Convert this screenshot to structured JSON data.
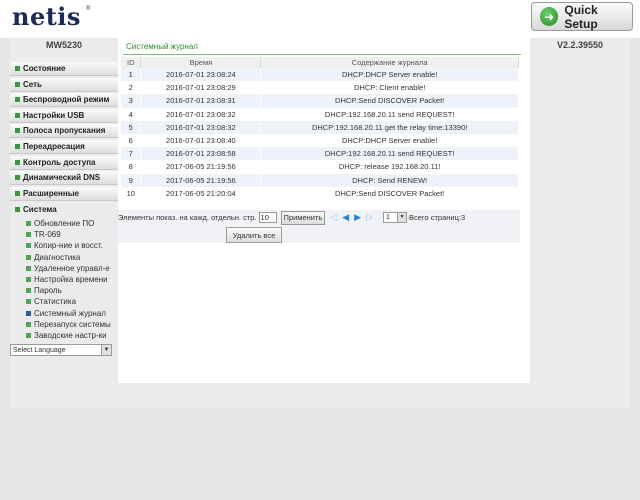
{
  "header": {
    "logo": "netis",
    "logo_mark": "®",
    "quick_setup": "Quick Setup"
  },
  "model": "MW5230",
  "version": "V2.2.39550",
  "sidebar": {
    "items": [
      {
        "label": "Состояние"
      },
      {
        "label": "Сеть"
      },
      {
        "label": "Беспроводной режим"
      },
      {
        "label": "Настройки USB"
      },
      {
        "label": "Полоса пропускания"
      },
      {
        "label": "Переадресация"
      },
      {
        "label": "Контроль доступа"
      },
      {
        "label": "Динамический DNS"
      },
      {
        "label": "Расширенные"
      },
      {
        "label": "Система"
      }
    ],
    "system_sub": [
      {
        "label": "Обновление ПО"
      },
      {
        "label": "TR-069"
      },
      {
        "label": "Копир-ние и восст."
      },
      {
        "label": "Диагностика"
      },
      {
        "label": "Удаленное управл-е"
      },
      {
        "label": "Настройка времени"
      },
      {
        "label": "Пароль"
      },
      {
        "label": "Статистика"
      },
      {
        "label": "Системный журнал"
      },
      {
        "label": "Перезапуск системы"
      },
      {
        "label": "Заводские настр-ки"
      }
    ],
    "language": "Select Language"
  },
  "log": {
    "title": "Системный журнал",
    "columns": [
      "ID",
      "Время",
      "Содержание журнала"
    ],
    "rows": [
      {
        "id": "1",
        "time": "2016-07-01 23:08:24",
        "msg": "DHCP:DHCP Server enable!"
      },
      {
        "id": "2",
        "time": "2016-07-01 23:08:29",
        "msg": "DHCP: Client enable!"
      },
      {
        "id": "3",
        "time": "2016-07-01 23:08:31",
        "msg": "DHCP:Send DISCOVER Packet!"
      },
      {
        "id": "4",
        "time": "2016-07-01 23:08:32",
        "msg": "DHCP:192.168.20.11 send REQUEST!"
      },
      {
        "id": "5",
        "time": "2016-07-01 23:08:32",
        "msg": "DHCP:192.168.20.11 get the relay time:13390!"
      },
      {
        "id": "6",
        "time": "2016-07-01 23:08:40",
        "msg": "DHCP:DHCP Server enable!"
      },
      {
        "id": "7",
        "time": "2016-07-01 23:08:58",
        "msg": "DHCP:192.168.20.11 send REQUEST!"
      },
      {
        "id": "8",
        "time": "2017-06-05 21:19:56",
        "msg": "DHCP: release 192.168.20.11!"
      },
      {
        "id": "9",
        "time": "2017-06-05 21:19:56",
        "msg": "DHCP: Send RENEW!"
      },
      {
        "id": "10",
        "time": "2017-06-05 21:20:04",
        "msg": "DHCP:Send DISCOVER Packet!"
      }
    ]
  },
  "pager": {
    "per_page_label": "Элементы показ. на кажд. отдельн. стр.",
    "per_page_value": "10",
    "apply": "Применить",
    "first_icon": "first-page-icon",
    "prev_icon": "prev-page-icon",
    "next_icon": "next-page-icon",
    "last_icon": "last-page-icon",
    "page_value": "1",
    "total_pages": "Всего страниц:3",
    "clear_all": "Удалить все"
  },
  "colors": {
    "accent_green": "#2b8a2b",
    "nav_icon": "#3a9a3a",
    "pager_icon": "#2a7fd4",
    "row_alt": "#eef3f9"
  }
}
